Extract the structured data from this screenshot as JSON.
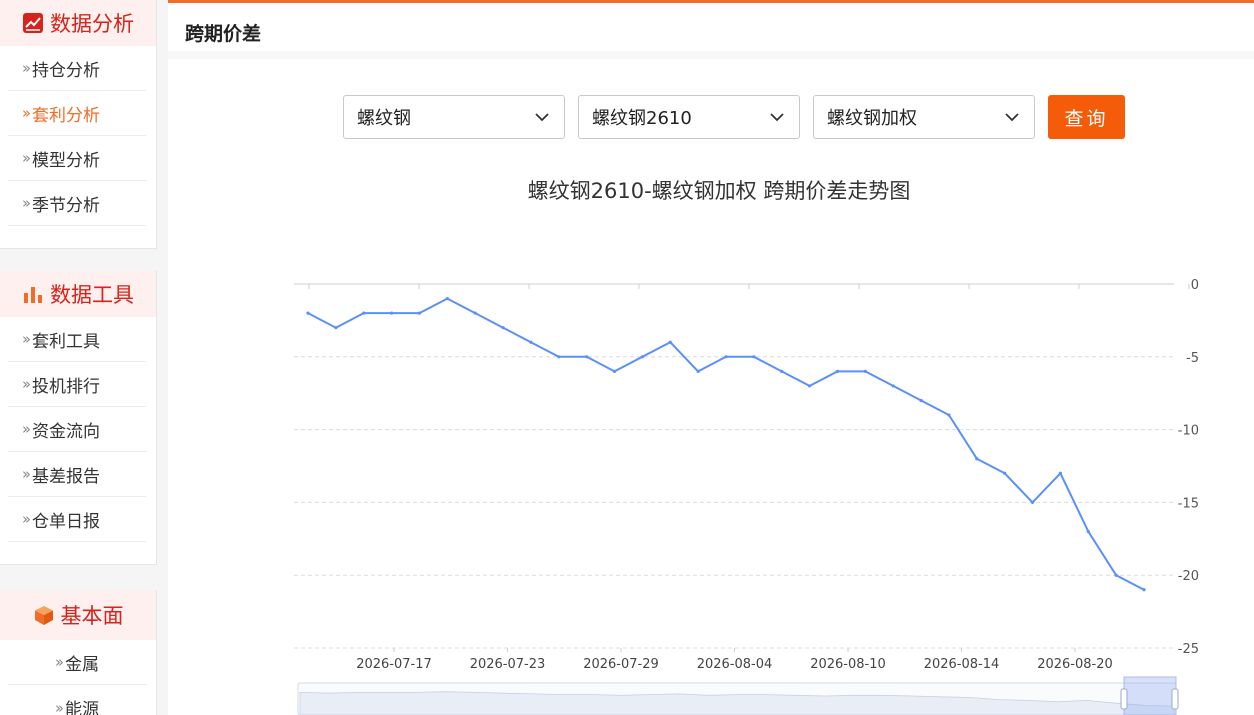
{
  "sidebar": {
    "sections": [
      {
        "title": "数据分析",
        "icon": "trend-chart-icon",
        "items": [
          {
            "label": "持仓分析",
            "active": false
          },
          {
            "label": "套利分析",
            "active": true
          },
          {
            "label": "模型分析",
            "active": false
          },
          {
            "label": "季节分析",
            "active": false
          }
        ]
      },
      {
        "title": "数据工具",
        "icon": "bar-chart-icon",
        "items": [
          {
            "label": "套利工具"
          },
          {
            "label": "投机排行"
          },
          {
            "label": "资金流向"
          },
          {
            "label": "基差报告"
          },
          {
            "label": "仓单日报"
          }
        ]
      },
      {
        "title": "基本面",
        "icon": "cube-icon",
        "items": [
          {
            "label": "金属"
          },
          {
            "label": "能源"
          }
        ]
      }
    ]
  },
  "page": {
    "title": "跨期价差"
  },
  "filters": {
    "product": "螺纹钢",
    "contract_a": "螺纹钢2610",
    "contract_b": "螺纹钢加权",
    "query_label": "查询"
  },
  "colors": {
    "accent": "#f06c27",
    "button": "#f45c0a",
    "brand_red": "#d6231b",
    "series": "#5b8ff9"
  },
  "chart_data": {
    "type": "line",
    "title": "螺纹钢2610-螺纹钢加权 跨期价差走势图",
    "xlabel": "",
    "ylabel": "",
    "ylim": [
      -25,
      0
    ],
    "yticks": [
      0,
      -5,
      -10,
      -15,
      -20,
      -25
    ],
    "x_tick_labels": [
      "2026-07-17",
      "2026-07-23",
      "2026-07-29",
      "2026-08-04",
      "2026-08-10",
      "2026-08-14",
      "2026-08-20"
    ],
    "grid": true,
    "legend": "none",
    "series": [
      {
        "values": [
          -2,
          -3,
          -2,
          -2,
          -2,
          -1,
          -2,
          -3,
          -4,
          -5,
          -5,
          -6,
          -5,
          -4,
          -6,
          -5,
          -5,
          -6,
          -7,
          -6,
          -6,
          -7,
          -8,
          -9,
          -12,
          -13,
          -15,
          -13,
          -17,
          -20,
          -21
        ]
      }
    ]
  }
}
